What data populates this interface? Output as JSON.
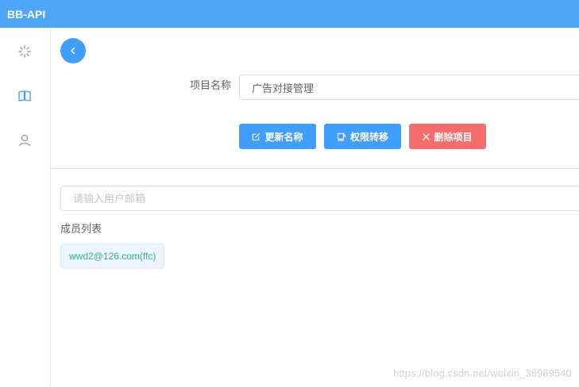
{
  "app": {
    "title": "BB-API"
  },
  "sidebar": {
    "items": [
      {
        "icon": "loading-icon"
      },
      {
        "icon": "book-icon"
      },
      {
        "icon": "user-icon"
      }
    ]
  },
  "project": {
    "name_label": "项目名称",
    "name_value": "广告对接管理"
  },
  "actions": {
    "rename_label": "更新名称",
    "transfer_label": "权限转移",
    "delete_label": "删除项目"
  },
  "members": {
    "search_placeholder": "请输入用户邮箱",
    "list_title": "成员列表",
    "items": [
      {
        "label": "wwd2@126.com(ffc)"
      }
    ]
  },
  "colors": {
    "header": "#4fa6f8",
    "primary": "#409eff",
    "danger": "#f56c6c",
    "tag_text": "#2bb38a"
  },
  "watermark": "https://blog.csdn.net/weixin_38989540"
}
